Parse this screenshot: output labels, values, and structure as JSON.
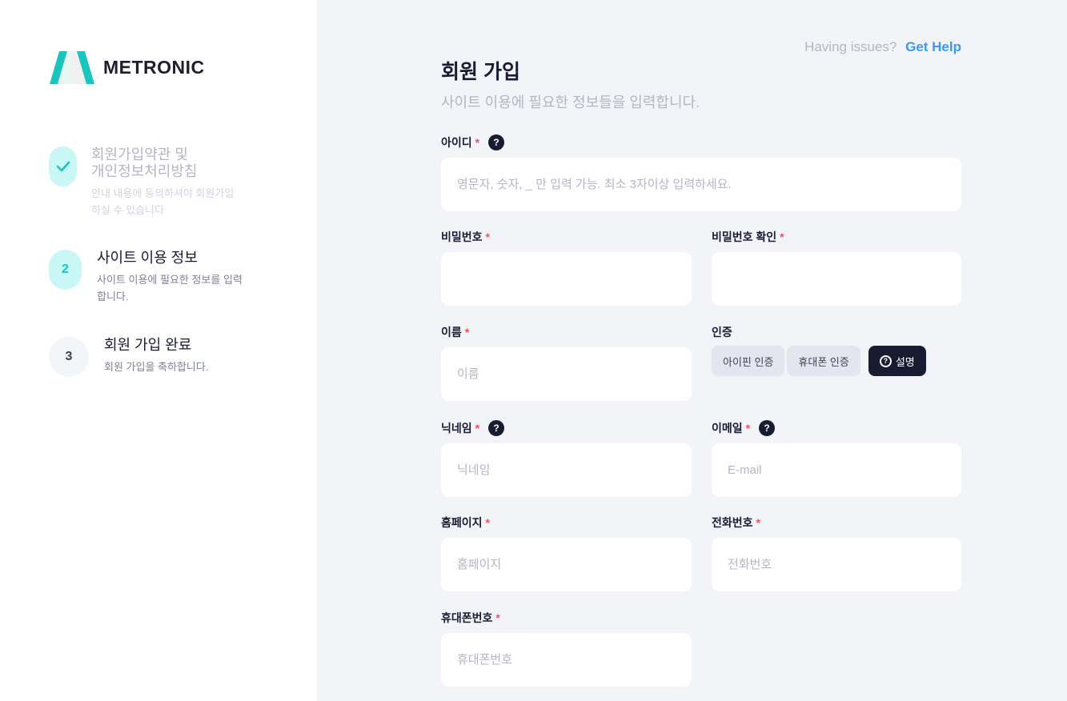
{
  "brand": {
    "name": "METRONIC"
  },
  "help": {
    "question": "Having issues?",
    "link": "Get Help"
  },
  "steps": [
    {
      "number": "✓",
      "title_line1": "회원가입약관 및",
      "title_line2": "개인정보처리방침",
      "desc_line1": "안내 내용에 동의하셔야 회원가입",
      "desc_line2": "하실 수 있습니다"
    },
    {
      "number": "2",
      "title": "사이트 이용 정보",
      "desc_line1": "사이트 이용에 필요한 정보를 입력",
      "desc_line2": "합니다."
    },
    {
      "number": "3",
      "title": "회원 가입 완료",
      "desc": "회원 가입을 축하합니다."
    }
  ],
  "form": {
    "title": "회원 가입",
    "subtitle": "사이트 이용에 필요한 정보들을 입력합니다.",
    "required_mark": "*",
    "userid": {
      "label": "아이디",
      "placeholder": "영문자, 숫자, _ 만 입력 가능. 최소 3자이상 입력하세요."
    },
    "password": {
      "label": "비밀번호",
      "placeholder": ""
    },
    "password_confirm": {
      "label": "비밀번호 확인",
      "placeholder": ""
    },
    "name": {
      "label": "이름",
      "placeholder": "이름"
    },
    "auth": {
      "label": "인증",
      "ipin_label": "아이핀 인증",
      "phone_label": "휴대폰 인증",
      "info_label": "설명"
    },
    "nickname": {
      "label": "닉네임",
      "placeholder": "닉네임"
    },
    "email": {
      "label": "이메일",
      "placeholder": "E-mail"
    },
    "homepage": {
      "label": "홈페이지",
      "placeholder": "홈페이지"
    },
    "tel": {
      "label": "전화번호",
      "placeholder": "전화번호"
    },
    "mobile": {
      "label": "휴대폰번호",
      "placeholder": "휴대폰번호"
    }
  },
  "colors": {
    "accent": "#3699ff",
    "brand_green": "#1bc5bd",
    "required": "#f64e60",
    "dark": "#181c32"
  }
}
